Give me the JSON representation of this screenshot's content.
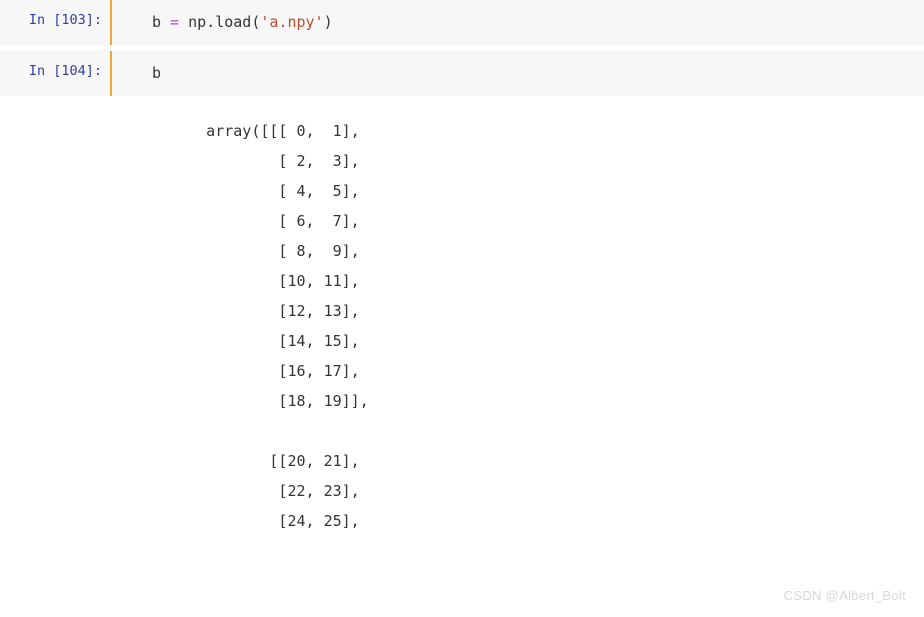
{
  "cells": {
    "cell103": {
      "prompt": "In [103]:",
      "code": {
        "var": "b",
        "assign": " = ",
        "call": "np.load(",
        "arg": "'a.npy'",
        "close": ")"
      }
    },
    "cell104": {
      "prompt": "In [104]:",
      "code": "b",
      "output": "      array([[[ 0,  1],\n              [ 2,  3],\n              [ 4,  5],\n              [ 6,  7],\n              [ 8,  9],\n              [10, 11],\n              [12, 13],\n              [14, 15],\n              [16, 17],\n              [18, 19]],\n\n             [[20, 21],\n              [22, 23],\n              [24, 25],"
    }
  },
  "watermark": "CSDN @Albert_Bolt"
}
